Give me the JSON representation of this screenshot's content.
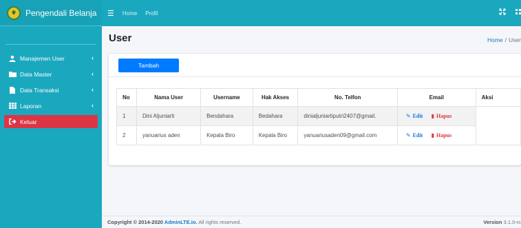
{
  "brand": {
    "title": "Pengendali Belanja",
    "logo_text": "⚜"
  },
  "topnav": {
    "home": "Home",
    "profil": "Profil"
  },
  "sidebar": {
    "items": [
      {
        "label": "Manajemen User",
        "icon": "user-icon",
        "chevron": "‹"
      },
      {
        "label": "Data Master",
        "icon": "folder-icon",
        "chevron": "‹"
      },
      {
        "label": "Data Transaksi",
        "icon": "file-icon",
        "chevron": "‹"
      },
      {
        "label": "Laporan",
        "icon": "table-icon",
        "chevron": "‹"
      },
      {
        "label": "Keluar",
        "icon": "sign-out-icon"
      }
    ]
  },
  "page": {
    "title": "User"
  },
  "breadcrumb": {
    "home": "Home",
    "sep": "/",
    "current": "User"
  },
  "toolbar": {
    "tambah_label": "Tambah"
  },
  "table": {
    "headers": [
      "No",
      "Nama User",
      "Username",
      "Hak Akses",
      "No. Telfon",
      "Email",
      "Aksi"
    ],
    "rows": [
      {
        "no": "1",
        "nama": "Dini Aljuniarti",
        "username": "Bendahara",
        "hak": "Bedahara",
        "telfon": "dinialjuniartiputri2407@gmail.",
        "edit": "Edit",
        "hapus": "Hapus"
      },
      {
        "no": "2",
        "nama": "yanuarius aden",
        "username": "Kepala Biro",
        "hak": "Kepala Biro",
        "telfon": "yanuariusaden09@gmail.com",
        "edit": "Edit",
        "hapus": "Hapus"
      }
    ]
  },
  "footer": {
    "copyright_prefix": "Copyright © 2014-2020 ",
    "brand_link": "AdminLTE.io.",
    "suffix": " All rights reserved.",
    "version_label": "Version",
    "version_value": " 3.1.0-rc"
  },
  "colors": {
    "primary": "#1aa8bf",
    "danger": "#dc3545",
    "button": "#007bff"
  }
}
